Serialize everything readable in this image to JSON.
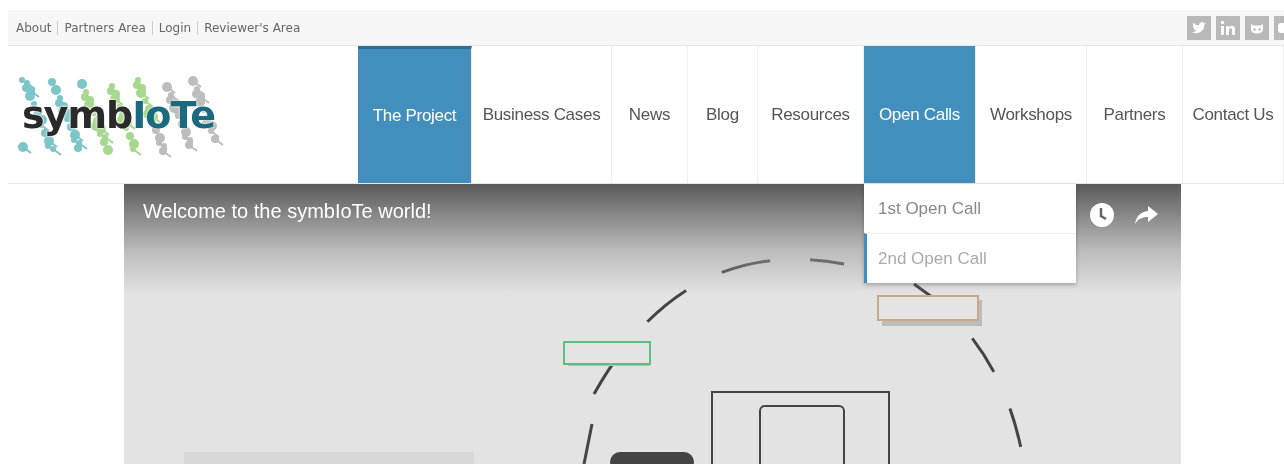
{
  "top_links": [
    "About",
    "Partners Area",
    "Login",
    "Reviewer's Area"
  ],
  "logo": {
    "text_dark": "symb",
    "text_accent": "IoTe"
  },
  "nav": [
    {
      "label": "The Project",
      "selected": true,
      "expanded": false
    },
    {
      "label": "Business Cases",
      "selected": false,
      "expanded": false
    },
    {
      "label": "News",
      "selected": false,
      "expanded": false
    },
    {
      "label": "Blog",
      "selected": false,
      "expanded": false
    },
    {
      "label": "Resources",
      "selected": false,
      "expanded": false
    },
    {
      "label": "Open Calls",
      "selected": false,
      "expanded": true,
      "menu": [
        {
          "label": "1st Open Call",
          "selected": false
        },
        {
          "label": "2nd Open Call",
          "selected": true
        }
      ]
    },
    {
      "label": "Workshops",
      "selected": false,
      "expanded": false
    },
    {
      "label": "Partners",
      "selected": false,
      "expanded": false
    },
    {
      "label": "Contact Us",
      "selected": false,
      "expanded": false
    }
  ],
  "video": {
    "title": "Welcome to the symbIoTe world!"
  }
}
